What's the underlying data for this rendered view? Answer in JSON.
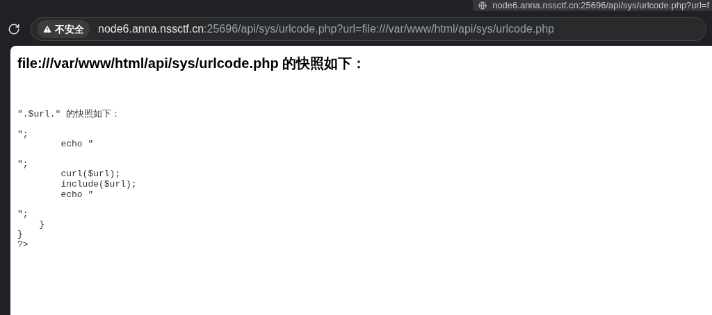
{
  "tooltip": {
    "url": "node6.anna.nssctf.cn:25696/api/sys/urlcode.php?url=f"
  },
  "address_bar": {
    "security": "不安全",
    "host": "node6.anna.nssctf.cn",
    "path": ":25696/api/sys/urlcode.php?url=file:///var/www/html/api/sys/urlcode.php"
  },
  "page": {
    "heading": "file:///var/www/html/api/sys/urlcode.php 的快照如下：",
    "code_blocks": [
      [
        "″.$url.″ 的快照如下："
      ],
      [
        "″;",
        "        echo ″"
      ],
      [
        "″;",
        "        curl($url);",
        "        include($url);",
        "        echo ″"
      ],
      [
        "″;",
        "    }",
        "}",
        "?>"
      ]
    ]
  }
}
